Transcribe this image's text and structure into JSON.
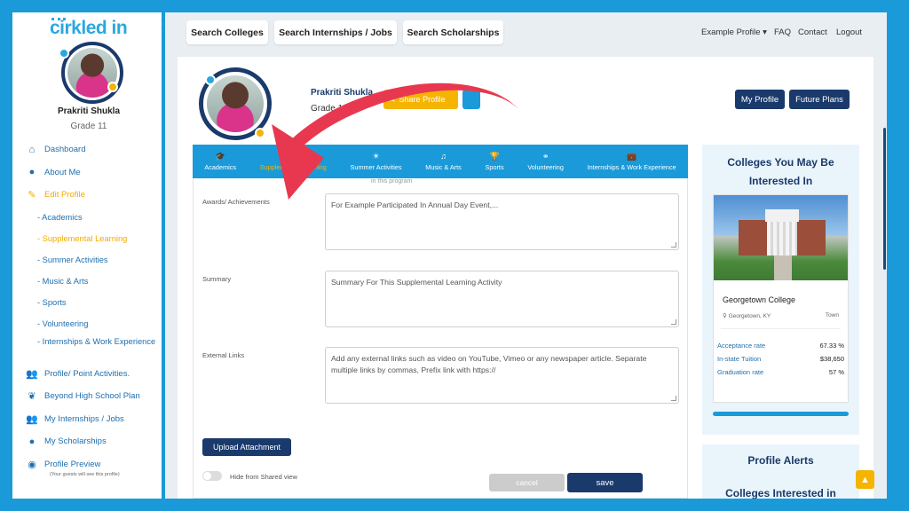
{
  "sidebar": {
    "logo": "cirkled in",
    "name": "Prakriti Shukla",
    "grade": "Grade 11",
    "items": [
      {
        "label": "Dashboard",
        "icon": "home-icon"
      },
      {
        "label": "About Me",
        "icon": "user-icon"
      },
      {
        "label": "Edit Profile",
        "icon": "edit-icon",
        "active": true
      },
      {
        "label": "- Academics"
      },
      {
        "label": "- Supplemental Learning",
        "active": true
      },
      {
        "label": "- Summer Activities"
      },
      {
        "label": "- Music & Arts"
      },
      {
        "label": "- Sports"
      },
      {
        "label": "- Volunteering"
      },
      {
        "label": "- Internships & Work Experience"
      },
      {
        "label": "Profile/ Point Activities.",
        "icon": "users-icon"
      },
      {
        "label": "Beyond High School Plan",
        "icon": "leaf-icon"
      },
      {
        "label": "My Internships / Jobs",
        "icon": "users-icon"
      },
      {
        "label": "My Scholarships",
        "icon": "user-icon"
      },
      {
        "label": "Profile Preview",
        "icon": "eye-icon"
      }
    ],
    "preview_note": "(Your guests will see this profile)"
  },
  "topnav": {
    "search_colleges": "Search Colleges",
    "search_internships": "Search Internships / Jobs",
    "search_scholarships": "Search Scholarships",
    "example_profile": "Example Profile ▾",
    "faq": "FAQ",
    "contact": "Contact",
    "logout": "Logout"
  },
  "profile": {
    "name": "Prakriti Shukla",
    "grade": "Grade 11",
    "share_label": "Share Profile",
    "my_profile": "My Profile",
    "future_plans": "Future Plans"
  },
  "tabs": [
    {
      "label": "Academics",
      "icon": "graduation-cap-icon"
    },
    {
      "label": "Supplemental Learning",
      "icon": "book-icon",
      "active": true
    },
    {
      "label": "Summer Activities",
      "icon": "sun-icon"
    },
    {
      "label": "Music & Arts",
      "icon": "music-icon"
    },
    {
      "label": "Sports",
      "icon": "trophy-icon"
    },
    {
      "label": "Volunteering",
      "icon": "handshake-icon"
    },
    {
      "label": "Internships & Work Experience",
      "icon": "briefcase-icon"
    }
  ],
  "form": {
    "faded_text": "in this program",
    "awards_label": "Awards/ Achievements",
    "awards_placeholder": "For Example Participated In Annual Day Event,...",
    "summary_label": "Summary",
    "summary_placeholder": "Summary For This Supplemental Learning Activity",
    "links_label": "External Links",
    "links_placeholder": "Add any external links such as video on YouTube, Vimeo or any newspaper article. Separate multiple links by commas, Prefix link with https://",
    "upload_label": "Upload Attachment",
    "hide_label": "Hide from Shared view",
    "cancel_label": "cancel",
    "save_label": "save"
  },
  "right_panel": {
    "title": "Colleges You May Be Interested In",
    "college": {
      "name": "Georgetown College",
      "location": "Georgetown, KY",
      "type": "Town",
      "stats": [
        {
          "label": "Acceptance rate",
          "value": "67.33 %"
        },
        {
          "label": "In-state Tuition",
          "value": "$38,650"
        },
        {
          "label": "Graduation rate",
          "value": "57 %"
        }
      ]
    },
    "alerts_title": "Profile Alerts",
    "alerts_sub": "Colleges Interested in"
  },
  "colors": {
    "frame_blue": "#1a9ad9",
    "navy": "#1a3a6b",
    "accent_yellow": "#f5b400",
    "arrow_red": "#e8384f"
  }
}
